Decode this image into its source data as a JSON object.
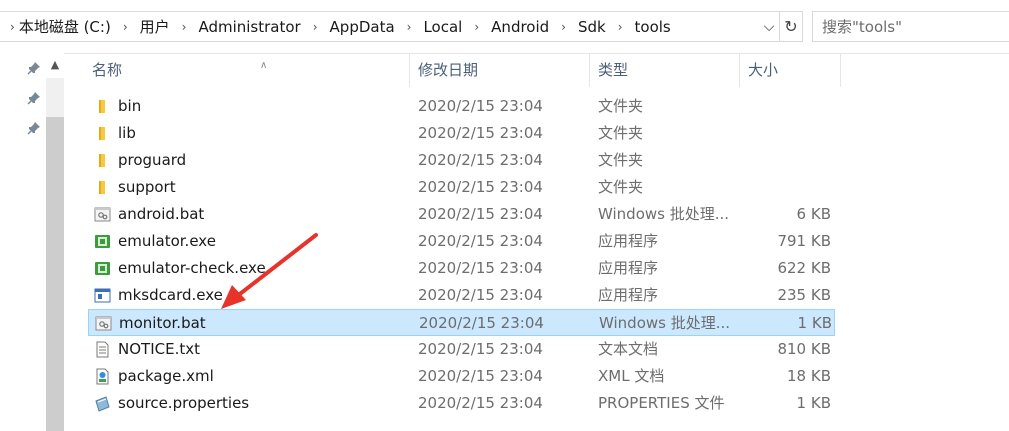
{
  "address": {
    "breadcrumbs": [
      "本地磁盘 (C:)",
      "用户",
      "Administrator",
      "AppData",
      "Local",
      "Android",
      "Sdk",
      "tools"
    ],
    "search_placeholder": "搜索\"tools\""
  },
  "columns": {
    "name": "名称",
    "date": "修改日期",
    "type": "类型",
    "size": "大小"
  },
  "files": [
    {
      "name": "bin",
      "date": "2020/2/15 23:04",
      "type": "文件夹",
      "size": "",
      "icon": "folder-icon"
    },
    {
      "name": "lib",
      "date": "2020/2/15 23:04",
      "type": "文件夹",
      "size": "",
      "icon": "folder-icon"
    },
    {
      "name": "proguard",
      "date": "2020/2/15 23:04",
      "type": "文件夹",
      "size": "",
      "icon": "folder-icon"
    },
    {
      "name": "support",
      "date": "2020/2/15 23:04",
      "type": "文件夹",
      "size": "",
      "icon": "folder-icon"
    },
    {
      "name": "android.bat",
      "date": "2020/2/15 23:04",
      "type": "Windows 批处理...",
      "size": "6 KB",
      "icon": "batch-file-icon"
    },
    {
      "name": "emulator.exe",
      "date": "2020/2/15 23:04",
      "type": "应用程序",
      "size": "791 KB",
      "icon": "app-exe-icon"
    },
    {
      "name": "emulator-check.exe",
      "date": "2020/2/15 23:04",
      "type": "应用程序",
      "size": "622 KB",
      "icon": "app-exe-icon"
    },
    {
      "name": "mksdcard.exe",
      "date": "2020/2/15 23:04",
      "type": "应用程序",
      "size": "235 KB",
      "icon": "window-exe-icon"
    },
    {
      "name": "monitor.bat",
      "date": "2020/2/15 23:04",
      "type": "Windows 批处理...",
      "size": "1 KB",
      "icon": "batch-file-icon",
      "selected": true
    },
    {
      "name": "NOTICE.txt",
      "date": "2020/2/15 23:04",
      "type": "文本文档",
      "size": "810 KB",
      "icon": "text-file-icon"
    },
    {
      "name": "package.xml",
      "date": "2020/2/15 23:04",
      "type": "XML 文档",
      "size": "18 KB",
      "icon": "xml-file-icon"
    },
    {
      "name": "source.properties",
      "date": "2020/2/15 23:04",
      "type": "PROPERTIES 文件",
      "size": "1 KB",
      "icon": "properties-file-icon"
    }
  ],
  "colors": {
    "selection_bg": "#cce8ff",
    "selection_border": "#99d1ff",
    "annotation_arrow": "#e8332a",
    "folder": "#f8c93e"
  }
}
